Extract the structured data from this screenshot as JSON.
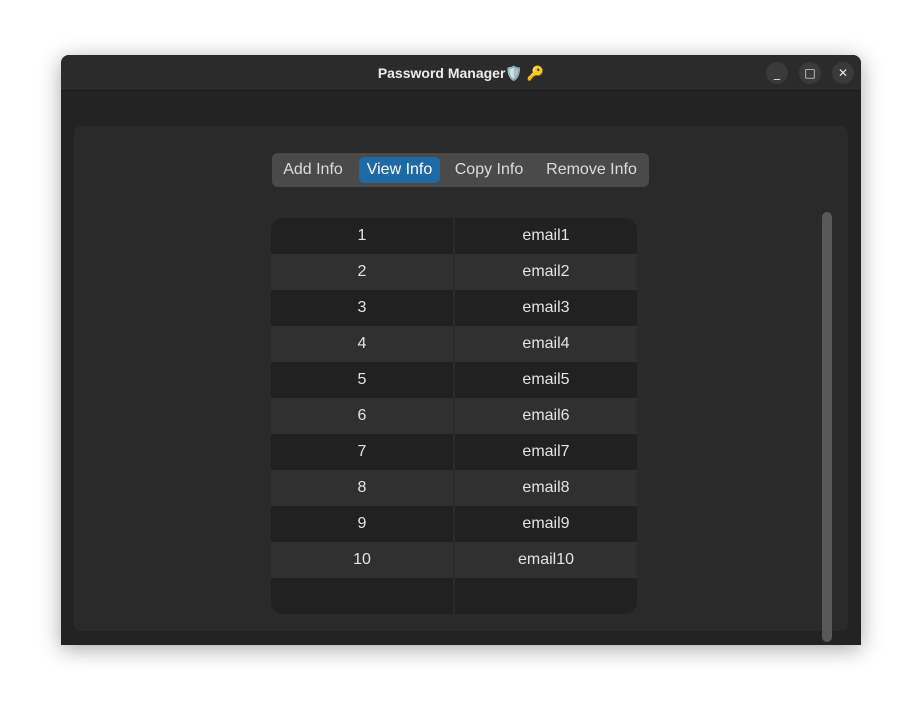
{
  "window": {
    "title": "Password Manager",
    "title_emoji": "🛡️ 🔑",
    "controls": {
      "minimize": "_",
      "maximize": "□",
      "close": "✕"
    }
  },
  "tabs": [
    {
      "label": "Add Info",
      "active": false
    },
    {
      "label": "View Info",
      "active": true
    },
    {
      "label": "Copy Info",
      "active": false
    },
    {
      "label": "Remove Info",
      "active": false
    }
  ],
  "table": {
    "rows": [
      {
        "id": "1",
        "email": "email1"
      },
      {
        "id": "2",
        "email": "email2"
      },
      {
        "id": "3",
        "email": "email3"
      },
      {
        "id": "4",
        "email": "email4"
      },
      {
        "id": "5",
        "email": "email5"
      },
      {
        "id": "6",
        "email": "email6"
      },
      {
        "id": "7",
        "email": "email7"
      },
      {
        "id": "8",
        "email": "email8"
      },
      {
        "id": "9",
        "email": "email9"
      },
      {
        "id": "10",
        "email": "email10"
      },
      {
        "id": "",
        "email": ""
      }
    ]
  },
  "colors": {
    "accent": "#1f6aa5",
    "window_bg": "#1e1e1e",
    "panel_bg": "#2a2a2a"
  }
}
